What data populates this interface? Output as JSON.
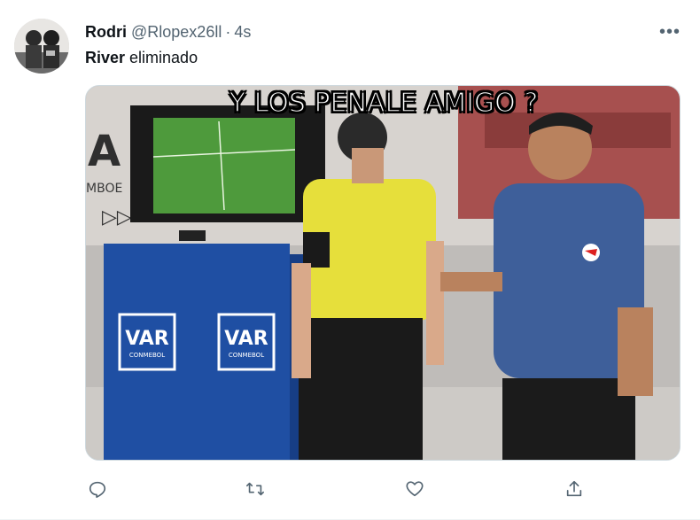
{
  "tweet": {
    "author_name": "Rodri",
    "author_handle": "@Rlopex26ll",
    "separator": "·",
    "time": "4s",
    "more_label": "•••",
    "text_bold": "River",
    "text_rest": " eliminado"
  },
  "media": {
    "caption": "Y LOS PENALE AMIGO ?",
    "var_label_1": "VAR",
    "var_sub_1": "CONMEBOL",
    "var_label_2": "VAR",
    "var_sub_2": "CONMEBOL"
  },
  "actions": {
    "reply": "reply-icon",
    "retweet": "retweet-icon",
    "like": "heart-icon",
    "share": "share-icon"
  },
  "colors": {
    "secondary_text": "#536471",
    "border": "#cfd9de"
  }
}
